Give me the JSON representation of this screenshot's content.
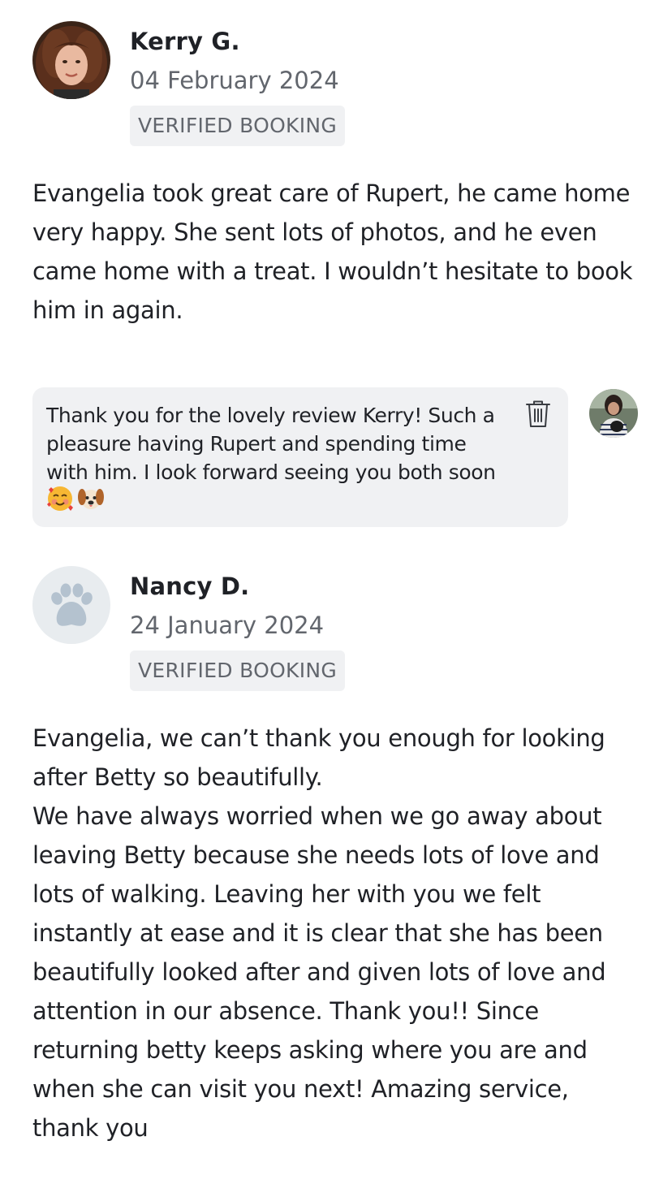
{
  "reviews": [
    {
      "name": "Kerry G.",
      "date": "04 February 2024",
      "badge": "VERIFIED BOOKING",
      "avatar_icon": "reviewer-photo",
      "text": "Evangelia took great care of Rupert, he came home\nvery happy. She sent lots of photos, and he even\ncame home with a treat. I wouldn’t hesitate to book\nhim in again."
    },
    {
      "name": "Nancy D.",
      "date": "24 January 2024",
      "badge": "VERIFIED BOOKING",
      "avatar_icon": "paw-icon",
      "text": "Evangelia, we can’t thank you enough for looking\nafter Betty so beautifully.\nWe have always worried when we go away about\nleaving Betty because she needs lots of love and\nlots of walking. Leaving her with you we felt\ninstantly at ease and it is clear that she has been\nbeautifully looked after and given lots of love and\nattention in our absence. Thank you!! Since\nreturning betty keeps asking where you are and\nwhen she can visit you next! Amazing service,\nthank you"
    }
  ],
  "reply": {
    "text": "Thank you for the lovely review Kerry! Such a\npleasure having Rupert and spending time\nwith him. I look forward seeing you both soon",
    "emojis": [
      "smiling-face-with-hearts-icon",
      "dog-face-icon"
    ],
    "delete_icon": "trash-icon",
    "host_avatar_icon": "host-photo"
  },
  "colors": {
    "text": "#1f2126",
    "muted": "#62666d",
    "badge_bg": "#f0f1f3",
    "reply_bg": "#f0f1f3",
    "paw_bg": "#e8ecef",
    "paw": "#b4c2cf"
  }
}
